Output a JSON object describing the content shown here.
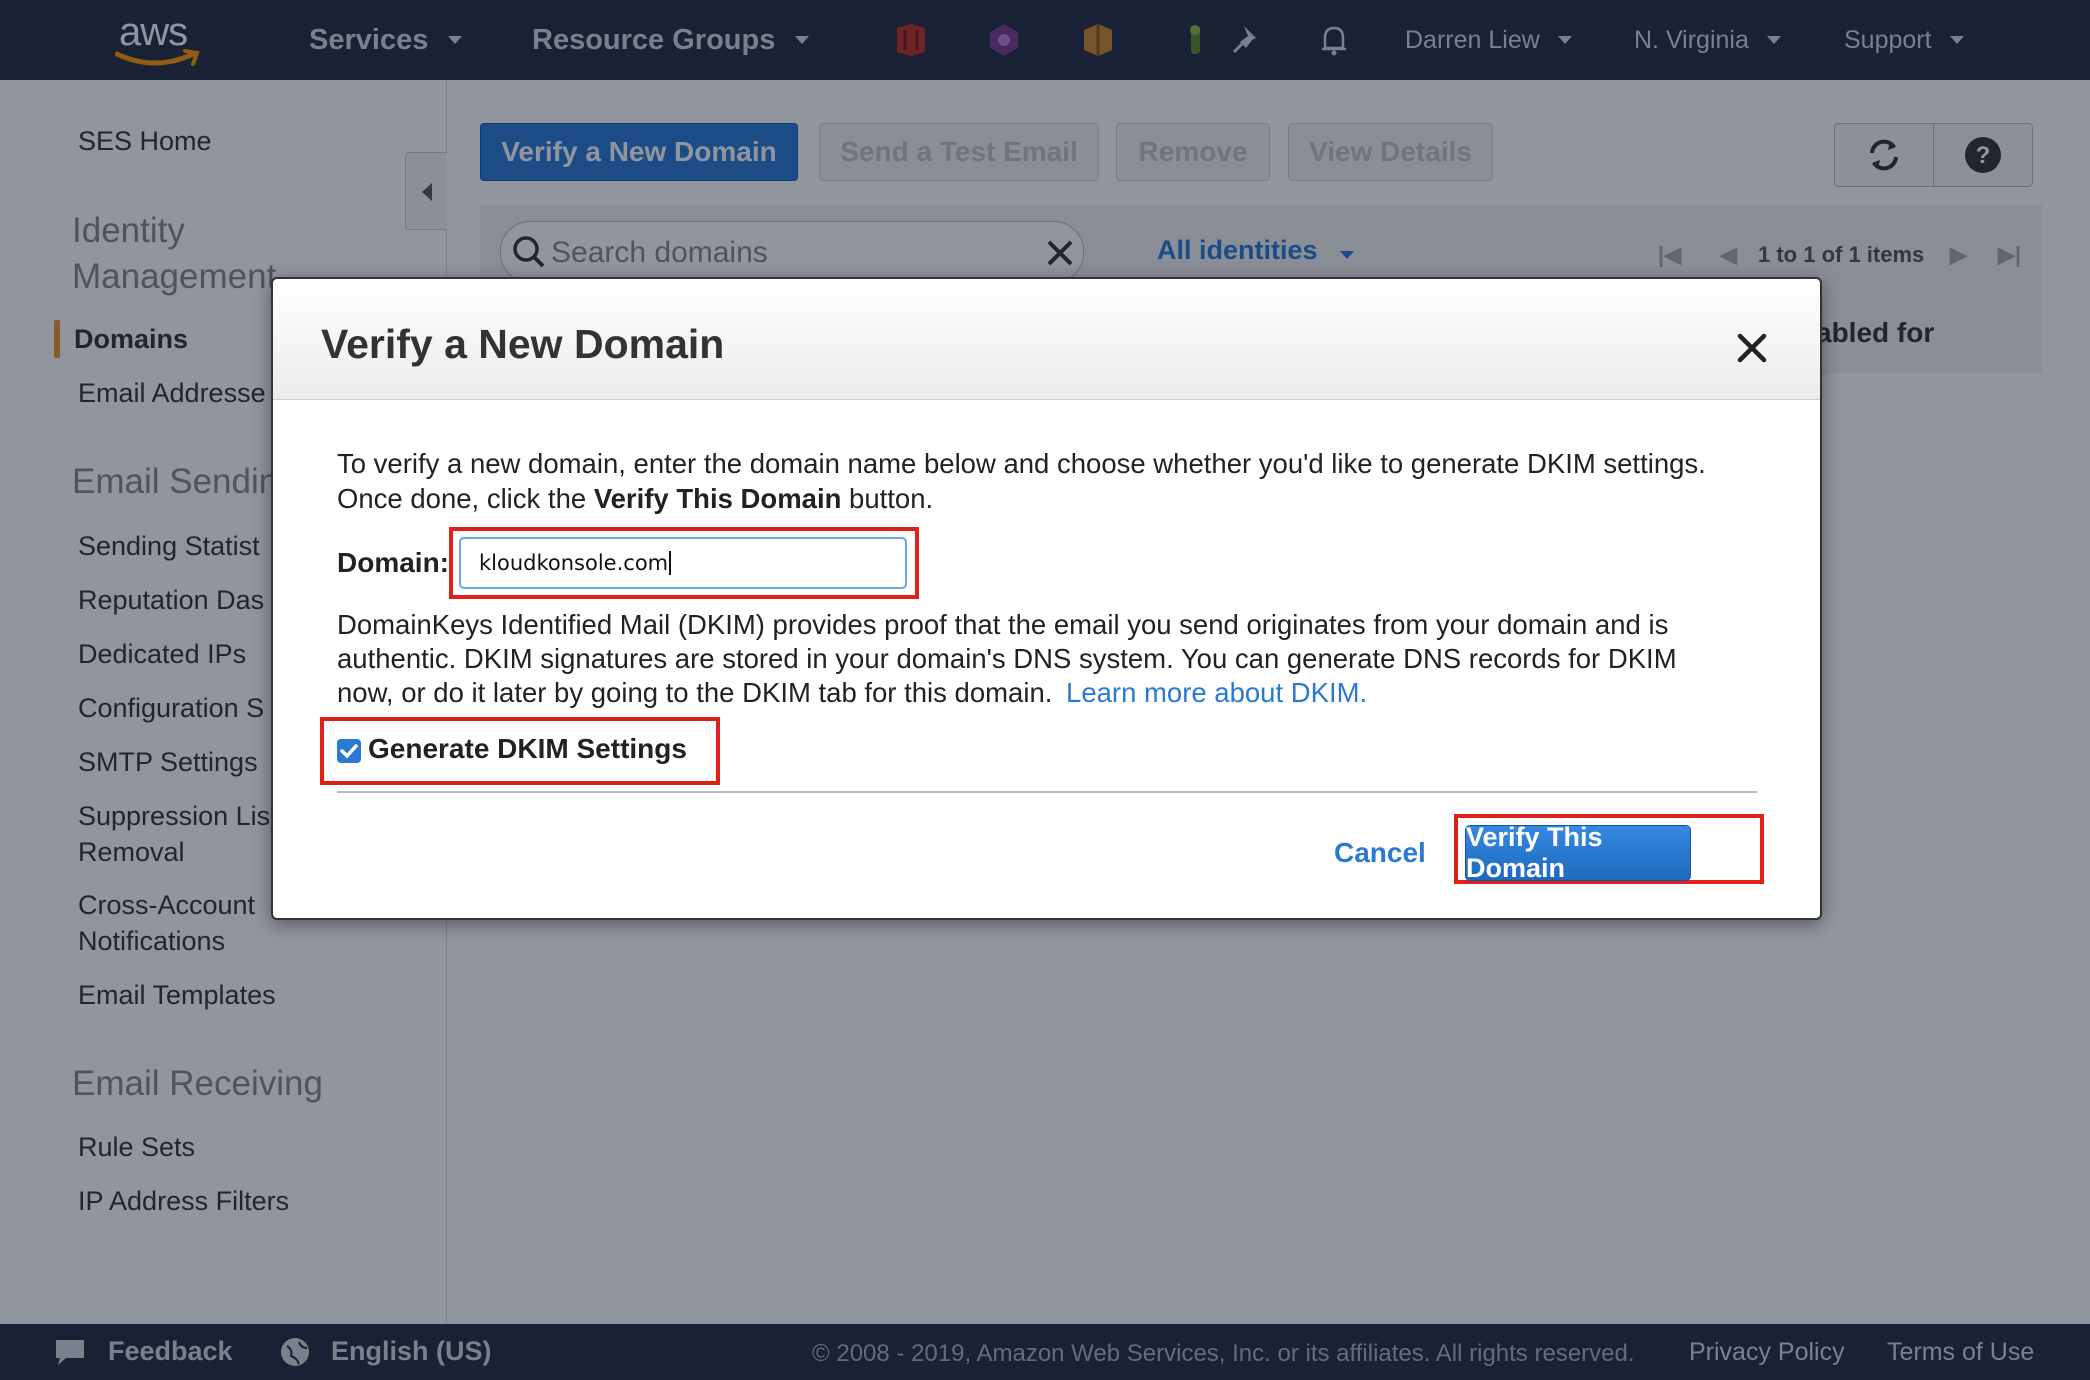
{
  "topnav": {
    "logo_text": "aws",
    "services": "Services",
    "resource_groups": "Resource Groups",
    "user": "Darren Liew",
    "region": "N. Virginia",
    "support": "Support",
    "service_icons": [
      "red-shield-icon",
      "purple-hexagon-icon",
      "orange-box-icon",
      "green-key-icon",
      "pin-icon",
      "bell-icon"
    ]
  },
  "sidebar": {
    "ses_home": "SES Home",
    "identity_heading": "Identity Management",
    "domains": "Domains",
    "email_addresses": "Email Addresse",
    "sending_heading": "Email Sendin",
    "sending_items": [
      "Sending Statist",
      "Reputation Das",
      "Dedicated IPs",
      "Configuration S",
      "SMTP Settings"
    ],
    "suppression": [
      "Suppression Lis",
      "Removal"
    ],
    "cross_account": [
      "Cross-Account",
      "Notifications"
    ],
    "email_templates": "Email Templates",
    "receiving_heading": "Email Receiving",
    "receiving_items": [
      "Rule Sets",
      "IP Address Filters"
    ]
  },
  "toolbar": {
    "verify_new_domain": "Verify a New Domain",
    "send_test": "Send a Test Email",
    "remove": "Remove",
    "view_details": "View Details"
  },
  "filter": {
    "search_placeholder": "Search domains",
    "identities": "All identities",
    "pager": "1 to 1 of 1 items",
    "column_partial": "abled for"
  },
  "modal": {
    "title": "Verify a New Domain",
    "intro_line1": "To verify a new domain, enter the domain name below and choose whether you'd like to generate DKIM settings.",
    "intro_line2_pre": "Once done, click the ",
    "intro_line2_bold": "Verify This Domain",
    "intro_line2_post": " button.",
    "domain_label": "Domain:",
    "domain_value": "kloudkonsole.com",
    "dkim_text_1": "DomainKeys Identified Mail (DKIM) provides proof that the email you send originates from your domain and is",
    "dkim_text_2": "authentic. DKIM signatures are stored in your domain's DNS system. You can generate DNS records for DKIM",
    "dkim_text_3": "now, or do it later by going to the DKIM tab for this domain.",
    "learn_more": "Learn more about DKIM.",
    "dkim_checkbox_label": "Generate DKIM Settings",
    "dkim_checked": true,
    "cancel": "Cancel",
    "verify_button": "Verify This Domain"
  },
  "footer": {
    "feedback": "Feedback",
    "language": "English (US)",
    "copyright": "© 2008 - 2019, Amazon Web Services, Inc. or its affiliates. All rights reserved.",
    "privacy": "Privacy Policy",
    "terms": "Terms of Use"
  },
  "colors": {
    "nav_bg": "#232f3e",
    "accent_blue": "#2a7ad3",
    "highlight_red": "#e0211a",
    "active_orange": "#e7992f"
  }
}
